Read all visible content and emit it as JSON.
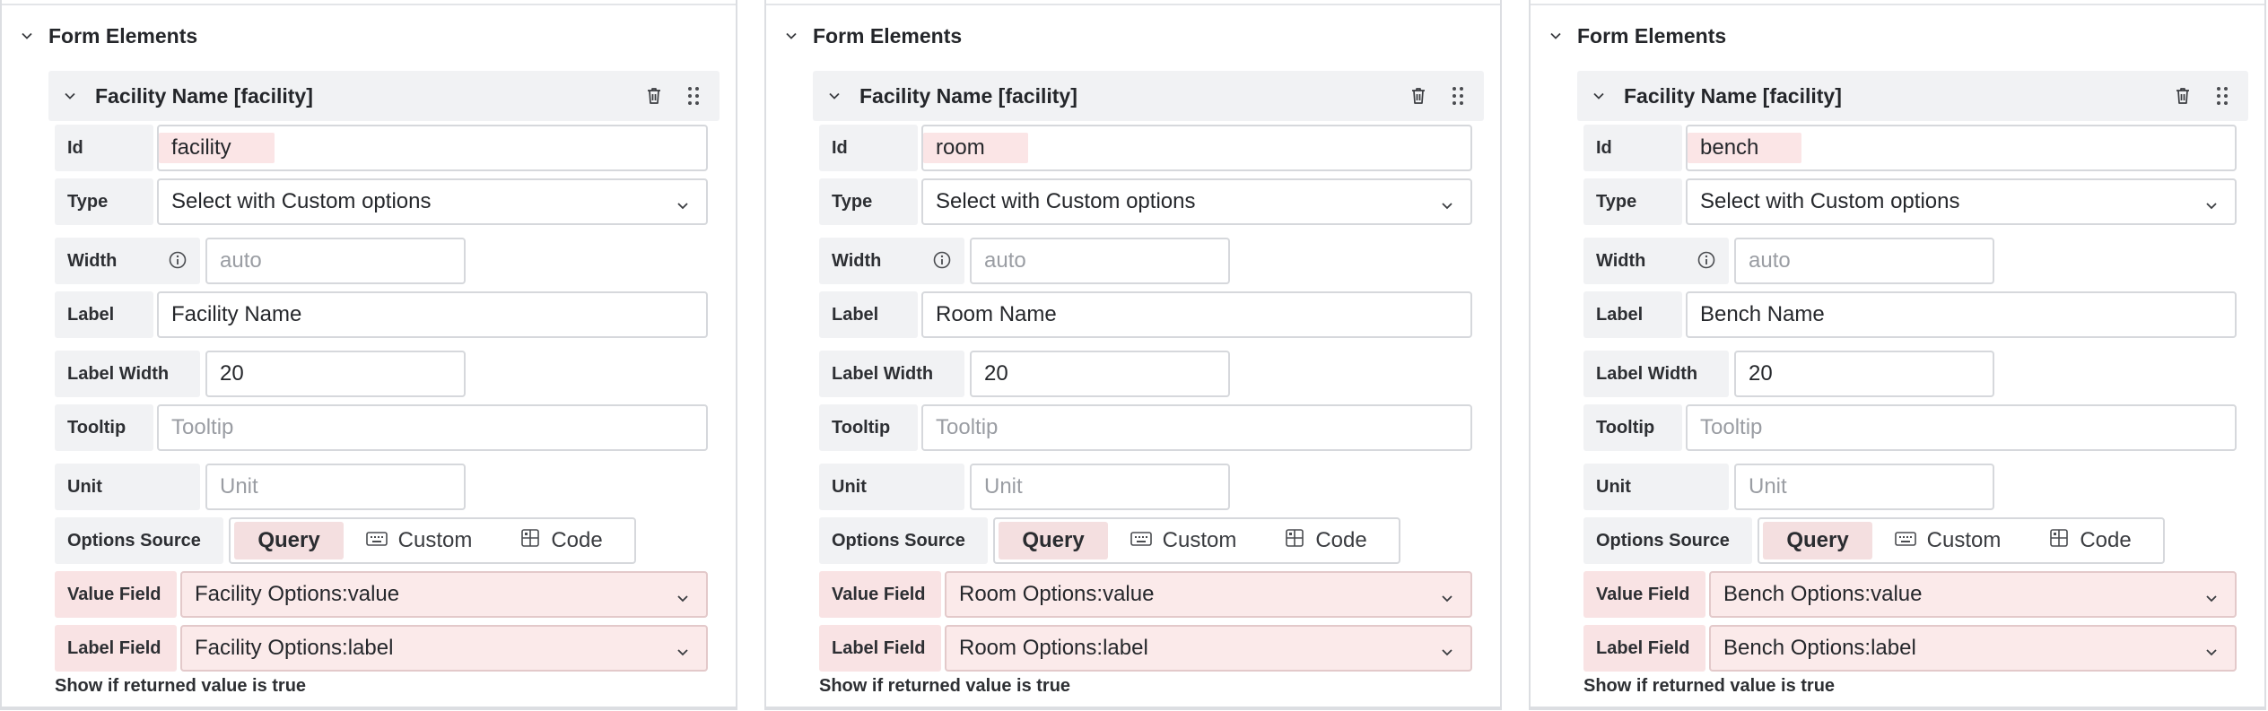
{
  "panels": [
    {
      "section_title": "Form Elements",
      "element_title": "Facility Name [facility]",
      "fields": {
        "id_label": "Id",
        "id_value": "facility",
        "type_label": "Type",
        "type_value": "Select with Custom options",
        "width_label": "Width",
        "width_placeholder": "auto",
        "label_label": "Label",
        "label_value": "Facility Name",
        "label_width_label": "Label Width",
        "label_width_value": "20",
        "tooltip_label": "Tooltip",
        "tooltip_placeholder": "Tooltip",
        "unit_label": "Unit",
        "unit_placeholder": "Unit",
        "options_source_label": "Options Source",
        "options_source_options": [
          "Query",
          "Custom",
          "Code"
        ],
        "options_source_selected": "Query",
        "value_field_label": "Value Field",
        "value_field_value": "Facility Options:value",
        "label_field_label": "Label Field",
        "label_field_value": "Facility Options:label",
        "show_if_text": "Show if returned value is true"
      }
    },
    {
      "section_title": "Form Elements",
      "element_title": "Facility Name [facility]",
      "fields": {
        "id_label": "Id",
        "id_value": "room",
        "type_label": "Type",
        "type_value": "Select with Custom options",
        "width_label": "Width",
        "width_placeholder": "auto",
        "label_label": "Label",
        "label_value": "Room Name",
        "label_width_label": "Label Width",
        "label_width_value": "20",
        "tooltip_label": "Tooltip",
        "tooltip_placeholder": "Tooltip",
        "unit_label": "Unit",
        "unit_placeholder": "Unit",
        "options_source_label": "Options Source",
        "options_source_options": [
          "Query",
          "Custom",
          "Code"
        ],
        "options_source_selected": "Query",
        "value_field_label": "Value Field",
        "value_field_value": "Room Options:value",
        "label_field_label": "Label Field",
        "label_field_value": "Room Options:label",
        "show_if_text": "Show if returned value is true"
      }
    },
    {
      "section_title": "Form Elements",
      "element_title": "Facility Name [facility]",
      "fields": {
        "id_label": "Id",
        "id_value": "bench",
        "type_label": "Type",
        "type_value": "Select with Custom options",
        "width_label": "Width",
        "width_placeholder": "auto",
        "label_label": "Label",
        "label_value": "Bench Name",
        "label_width_label": "Label Width",
        "label_width_value": "20",
        "tooltip_label": "Tooltip",
        "tooltip_placeholder": "Tooltip",
        "unit_label": "Unit",
        "unit_placeholder": "Unit",
        "options_source_label": "Options Source",
        "options_source_options": [
          "Query",
          "Custom",
          "Code"
        ],
        "options_source_selected": "Query",
        "value_field_label": "Value Field",
        "value_field_value": "Bench Options:value",
        "label_field_label": "Label Field",
        "label_field_value": "Bench Options:label",
        "show_if_text": "Show if returned value is true"
      }
    }
  ],
  "icons": {
    "section_toggle": "chevron-down-icon",
    "element_toggle": "chevron-down-icon",
    "delete": "trash-icon",
    "drag": "drag-handle-icon",
    "width_info": "info-icon",
    "dropdown": "chevron-down-icon",
    "custom_option": "keyboard-icon",
    "code_option": "grid-icon"
  },
  "colors": {
    "highlight_pink": "#fbeaea",
    "label_bg": "#f1f2f4",
    "border": "#d6d8dc"
  }
}
